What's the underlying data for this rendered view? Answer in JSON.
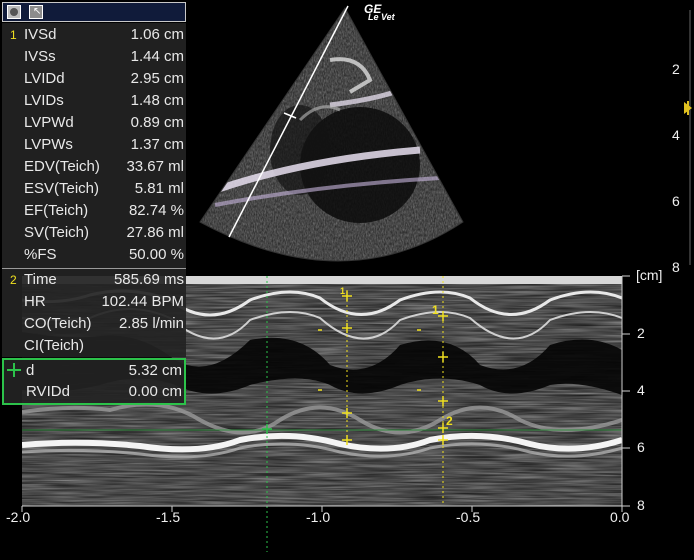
{
  "toolbar": {
    "button1": "circle-button",
    "button2": "cursor-button",
    "cursor_glyph": "↖"
  },
  "brand": {
    "logo": "GE",
    "probe": "Le Vet"
  },
  "measurements_group1": {
    "index": "1",
    "rows": [
      {
        "label": "IVSd",
        "value": "1.06 cm"
      },
      {
        "label": "IVSs",
        "value": "1.44 cm"
      },
      {
        "label": "LVIDd",
        "value": "2.95 cm"
      },
      {
        "label": "LVIDs",
        "value": "1.48 cm"
      },
      {
        "label": "LVPWd",
        "value": "0.89 cm"
      },
      {
        "label": "LVPWs",
        "value": "1.37 cm"
      },
      {
        "label": "EDV(Teich)",
        "value": "33.67 ml"
      },
      {
        "label": "ESV(Teich)",
        "value": "5.81 ml"
      },
      {
        "label": "EF(Teich)",
        "value": "82.74 %"
      },
      {
        "label": "SV(Teich)",
        "value": "27.86 ml"
      },
      {
        "label": "%FS",
        "value": "50.00 %"
      }
    ]
  },
  "measurements_group2": {
    "index": "2",
    "rows": [
      {
        "label": "Time",
        "value": "585.69 ms"
      },
      {
        "label": "HR",
        "value": "102.44 BPM"
      },
      {
        "label": "CO(Teich)",
        "value": "2.85 l/min"
      },
      {
        "label": "CI(Teich)",
        "value": ""
      }
    ]
  },
  "active_measurement": {
    "rows": [
      {
        "label": "d",
        "value": "5.32 cm"
      },
      {
        "label": "RVIDd",
        "value": "0.00 cm"
      }
    ]
  },
  "bmode_depth_scale": [
    "2",
    "4",
    "6",
    "8"
  ],
  "mmode_depth_unit": "[cm]",
  "mmode_depth_scale": [
    "2",
    "4",
    "6",
    "8"
  ],
  "time_axis": [
    "-2.0",
    "-1.5",
    "-1.0",
    "-0.5",
    "0.0"
  ],
  "caliper_labels": {
    "m1": "1",
    "m2": "2",
    "cycle1": "1"
  },
  "colors": {
    "caliper": "#f0e020",
    "active": "#2cc24a",
    "focus_marker": "#e0c020"
  }
}
